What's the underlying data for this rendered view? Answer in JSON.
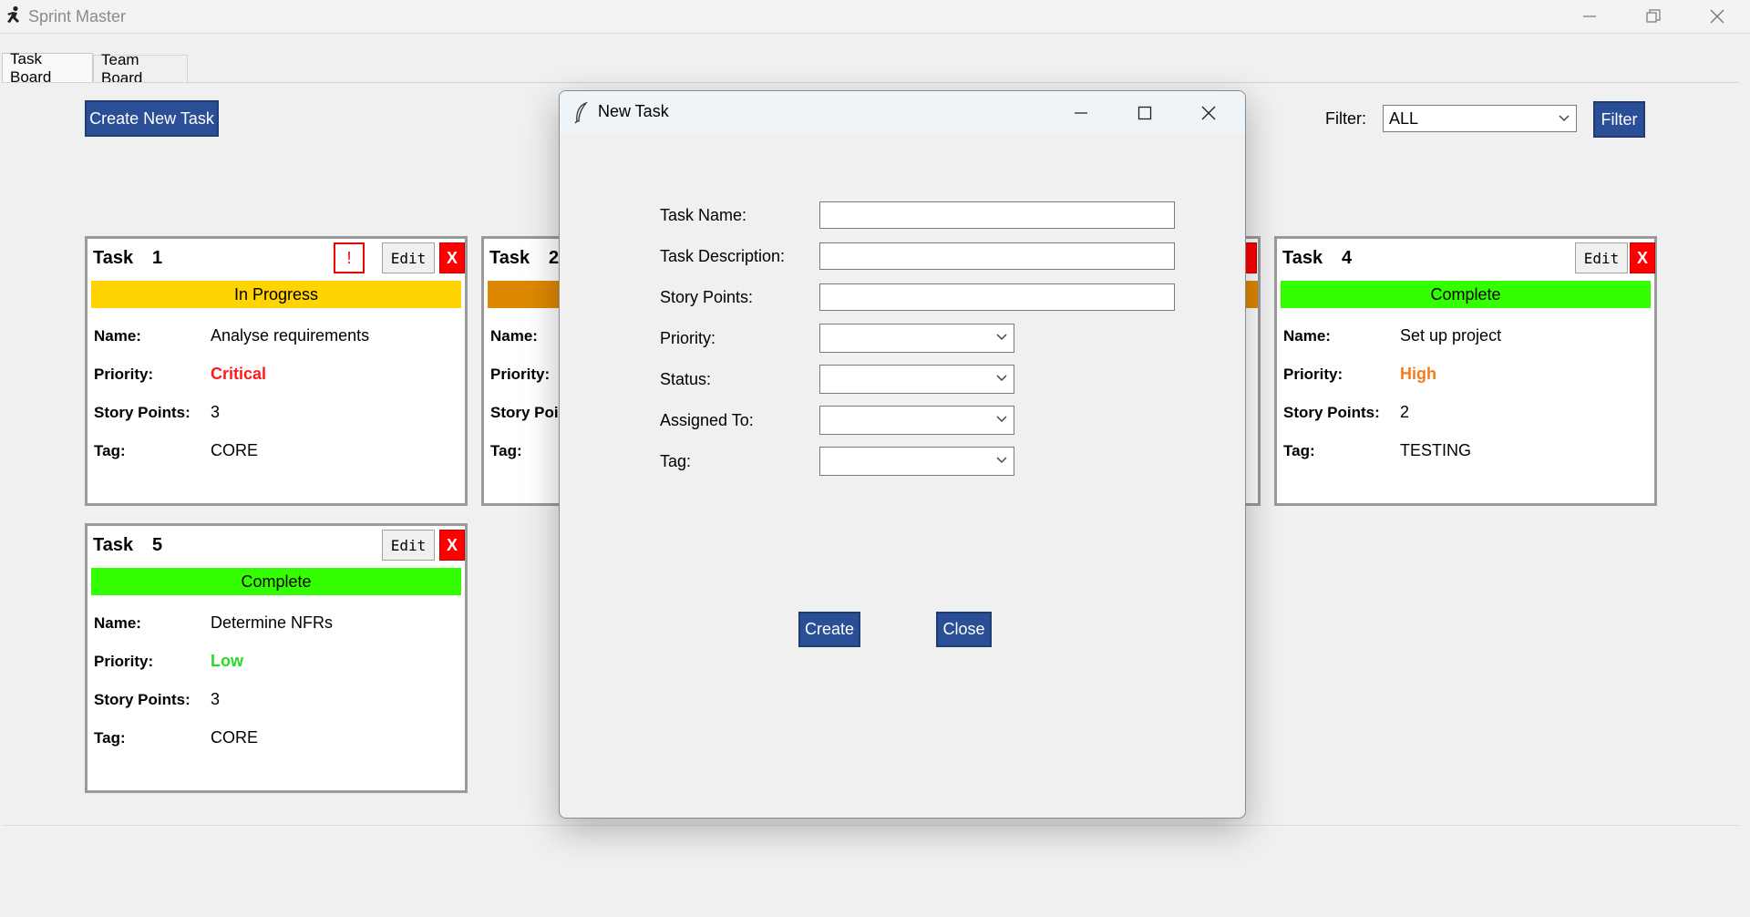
{
  "window": {
    "title": "Sprint Master"
  },
  "tabs": [
    {
      "label": "Task Board"
    },
    {
      "label": "Team Board"
    }
  ],
  "toolbar": {
    "create_label": "Create New Task",
    "filter_label": "Filter:",
    "filter_value": "ALL",
    "filter_button": "Filter"
  },
  "card_labels": {
    "task": "Task",
    "edit": "Edit",
    "delete": "X",
    "warn": "!",
    "name": "Name:",
    "priority": "Priority:",
    "points": "Story Points:",
    "tag": "Tag:"
  },
  "cards": [
    {
      "number": "1",
      "status": "In Progress",
      "status_color": "#ffd400",
      "name": "Analyse requirements",
      "priority": "Critical",
      "priority_color": "#ff1a1a",
      "points": "3",
      "tag": "CORE"
    },
    {
      "number": "2",
      "status": "",
      "status_color": "#dd8800",
      "name": "",
      "priority": "",
      "priority_color": "#000000",
      "points": "",
      "tag": "",
      "partial_labels": {
        "task": "Task",
        "num": "2",
        "name": "Name:",
        "priority": "Priority:",
        "points": "Story Poi",
        "tag": "Tag:"
      }
    },
    {
      "number": "4",
      "status": "Complete",
      "status_color": "#33ff00",
      "name": "Set up project",
      "priority": "High",
      "priority_color": "#f07c1c",
      "points": "2",
      "tag": "TESTING"
    },
    {
      "number": "5",
      "status": "Complete",
      "status_color": "#33ff00",
      "name": "Determine NFRs",
      "priority": "Low",
      "priority_color": "#22dd22",
      "points": "3",
      "tag": "CORE"
    }
  ],
  "dialog": {
    "title": "New Task",
    "labels": {
      "task_name": "Task Name:",
      "task_description": "Task Description:",
      "story_points": "Story Points:",
      "priority": "Priority:",
      "status": "Status:",
      "assigned_to": "Assigned To:",
      "tag": "Tag:"
    },
    "values": {
      "task_name": "",
      "task_description": "",
      "story_points": "",
      "priority": "",
      "status": "",
      "assigned_to": "",
      "tag": ""
    },
    "create_label": "Create",
    "close_label": "Close"
  },
  "colors": {
    "accent_button": "#2a4f96",
    "delete_button": "#ff0000"
  }
}
